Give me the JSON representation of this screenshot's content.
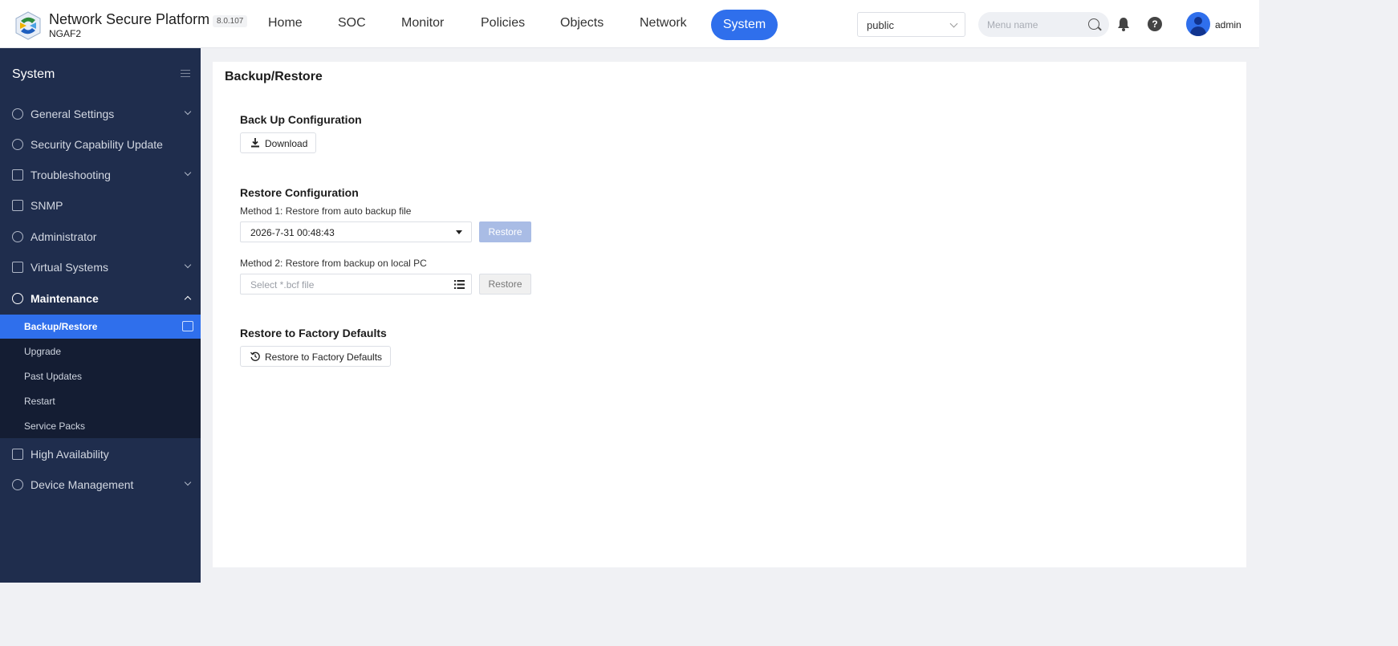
{
  "header": {
    "brand_title": "Network Secure Platform",
    "brand_sub": "NGAF2",
    "version": "8.0.107",
    "nav": [
      "Home",
      "SOC",
      "Monitor",
      "Policies",
      "Objects",
      "Network"
    ],
    "nav_active": "System",
    "vsys_selected": "public",
    "search_placeholder": "Menu name",
    "username": "admin",
    "help_glyph": "?",
    "accent_color": "#2f6fec"
  },
  "sidebar": {
    "title": "System",
    "items": [
      {
        "label": "General Settings",
        "icon": "gear-outline-icon",
        "expandable": true
      },
      {
        "label": "Security Capability Update",
        "icon": "shield-icon",
        "expandable": false
      },
      {
        "label": "Troubleshooting",
        "icon": "wrench-icon",
        "expandable": true
      },
      {
        "label": "SNMP",
        "icon": "snmp-icon",
        "expandable": false
      },
      {
        "label": "Administrator",
        "icon": "user-circle-icon",
        "expandable": false
      },
      {
        "label": "Virtual Systems",
        "icon": "virtual-systems-icon",
        "expandable": true
      },
      {
        "label": "Maintenance",
        "icon": "maintenance-gear-icon",
        "expandable": true,
        "open": true
      }
    ],
    "maintenance_sub": [
      "Backup/Restore",
      "Upgrade",
      "Past Updates",
      "Restart",
      "Service Packs"
    ],
    "items_after": [
      {
        "label": "High Availability",
        "icon": "ha-icon",
        "expandable": false
      },
      {
        "label": "Device Management",
        "icon": "device-gear-icon",
        "expandable": true
      }
    ]
  },
  "main": {
    "title": "Backup/Restore",
    "backup": {
      "title": "Back Up Configuration",
      "download_label": "Download"
    },
    "restore": {
      "title": "Restore Configuration",
      "method1_label": "Method 1: Restore from auto backup file",
      "method1_selected": "2026-7-31 00:48:43",
      "method1_button": "Restore",
      "method2_label": "Method 2: Restore from backup on local PC",
      "method2_placeholder": "Select *.bcf file",
      "method2_button": "Restore"
    },
    "factory": {
      "title": "Restore to Factory Defaults",
      "button_label": "Restore to Factory Defaults"
    }
  }
}
